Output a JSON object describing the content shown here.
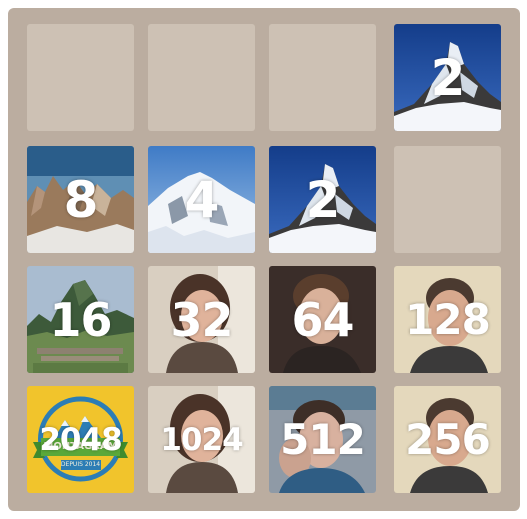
{
  "board": {
    "rows": [
      [
        {
          "value": "",
          "kind": "empty"
        },
        {
          "value": "",
          "kind": "empty"
        },
        {
          "value": "",
          "kind": "empty"
        },
        {
          "value": "2",
          "kind": "matterhorn"
        }
      ],
      [
        {
          "value": "8",
          "kind": "rocky-peaks"
        },
        {
          "value": "4",
          "kind": "snow-mountain"
        },
        {
          "value": "2",
          "kind": "matterhorn"
        },
        {
          "value": "",
          "kind": "empty"
        }
      ],
      [
        {
          "value": "16",
          "kind": "machu-picchu"
        },
        {
          "value": "32",
          "kind": "person-glasses"
        },
        {
          "value": "64",
          "kind": "person-dark"
        },
        {
          "value": "128",
          "kind": "person-smile"
        }
      ],
      [
        {
          "value": "2048",
          "kind": "montagram-logo"
        },
        {
          "value": "1024",
          "kind": "person-glasses"
        },
        {
          "value": "512",
          "kind": "person-hand"
        },
        {
          "value": "256",
          "kind": "person-smile"
        }
      ]
    ]
  },
  "logo": {
    "name": "MONTAGRAM",
    "since": "DEPUIS 2014",
    "colors": {
      "background": "#f1c42c",
      "mountain": "#2c7db5",
      "banner": "#5aa83a"
    }
  },
  "colors": {
    "board": "#bbada0",
    "empty_cell": "#cdc1b4",
    "tile_text": "#ffffff"
  }
}
